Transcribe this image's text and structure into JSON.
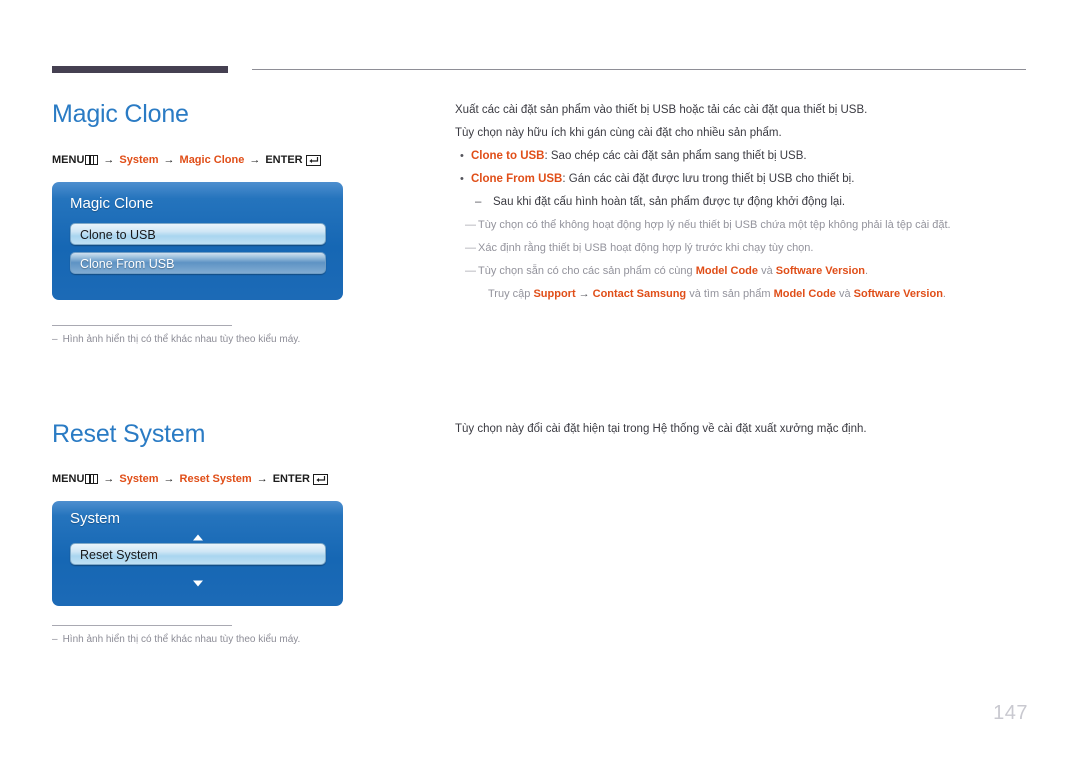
{
  "page": {
    "number": "147"
  },
  "sections": [
    {
      "heading": "Magic Clone",
      "menu_path": {
        "menu_label": "MENU",
        "menu_icon": "menu-bars-icon",
        "arrow": "→",
        "step1": "System",
        "step2": "Magic Clone",
        "enter_label": "ENTER",
        "enter_icon": "enter-return-icon"
      },
      "osd": {
        "title": "Magic Clone",
        "items": [
          {
            "label": "Clone to USB",
            "selected": true
          },
          {
            "label": "Clone From USB",
            "selected": false
          }
        ],
        "has_scroll_arrows": false
      },
      "footnote": {
        "dash": "–",
        "text": "Hình ảnh hiển thị có thể khác nhau tùy theo kiểu máy."
      }
    },
    {
      "heading": "Reset System",
      "menu_path": {
        "menu_label": "MENU",
        "menu_icon": "menu-bars-icon",
        "arrow": "→",
        "step1": "System",
        "step2": "Reset System",
        "enter_label": "ENTER",
        "enter_icon": "enter-return-icon"
      },
      "osd": {
        "title": "System",
        "items": [
          {
            "label": "Reset System",
            "selected": true
          }
        ],
        "has_scroll_arrows": true
      },
      "footnote": {
        "dash": "–",
        "text": "Hình ảnh hiển thị có thể khác nhau tùy theo kiểu máy."
      }
    }
  ],
  "magic_clone_content": {
    "para1": "Xuất các cài đặt sản phẩm vào thiết bị USB hoặc tải các cài đặt qua thiết bị USB.",
    "para2": "Tùy chọn này hữu ích khi gán cùng cài đặt cho nhiều sản phẩm.",
    "bullet_dot": "•",
    "bullets": [
      {
        "term": "Clone to USB",
        "rest": ": Sao chép các cài đặt sản phẩm sang thiết bị USB."
      },
      {
        "term": "Clone From USB",
        "rest": ": Gán các cài đặt được lưu trong thiết bị USB cho thiết bị."
      }
    ],
    "sub_dash": "–",
    "sub_item": "Sau khi đặt cấu hình hoàn tất, sản phẩm được tự động khởi động lại.",
    "note_mark": "―",
    "notes": [
      {
        "text": "Tùy chọn có thể không hoạt động hợp lý nếu thiết bị USB chứa một tệp không phải là tệp cài đặt."
      },
      {
        "text": "Xác định rằng thiết bị USB hoạt động hợp lý trước khi chạy tùy chọn."
      }
    ],
    "note3": {
      "lead": "Tùy chọn sẵn có cho các sản phẩm có cùng ",
      "term1": "Model Code",
      "mid1": " và ",
      "term2": "Software Version",
      "end1": ".",
      "cont_lead": "Truy cập ",
      "cont_term1": "Support",
      "cont_arrow": "→",
      "cont_term2": "Contact Samsung",
      "cont_mid": " và tìm sản phẩm ",
      "cont_term3": "Model Code",
      "cont_mid2": " và ",
      "cont_term4": "Software Version",
      "cont_end": "."
    }
  },
  "reset_system_content": {
    "para1": "Tùy chọn này đổi cài đặt hiện tại trong Hệ thống về cài đặt xuất xưởng mặc định."
  },
  "colors": {
    "heading_blue": "#2a7bc4",
    "term_orange": "#e04e18",
    "body_gray": "#3b3b42",
    "note_gray": "#93939c",
    "rule_dark": "#454051",
    "osd_blue": "#1667b4"
  }
}
